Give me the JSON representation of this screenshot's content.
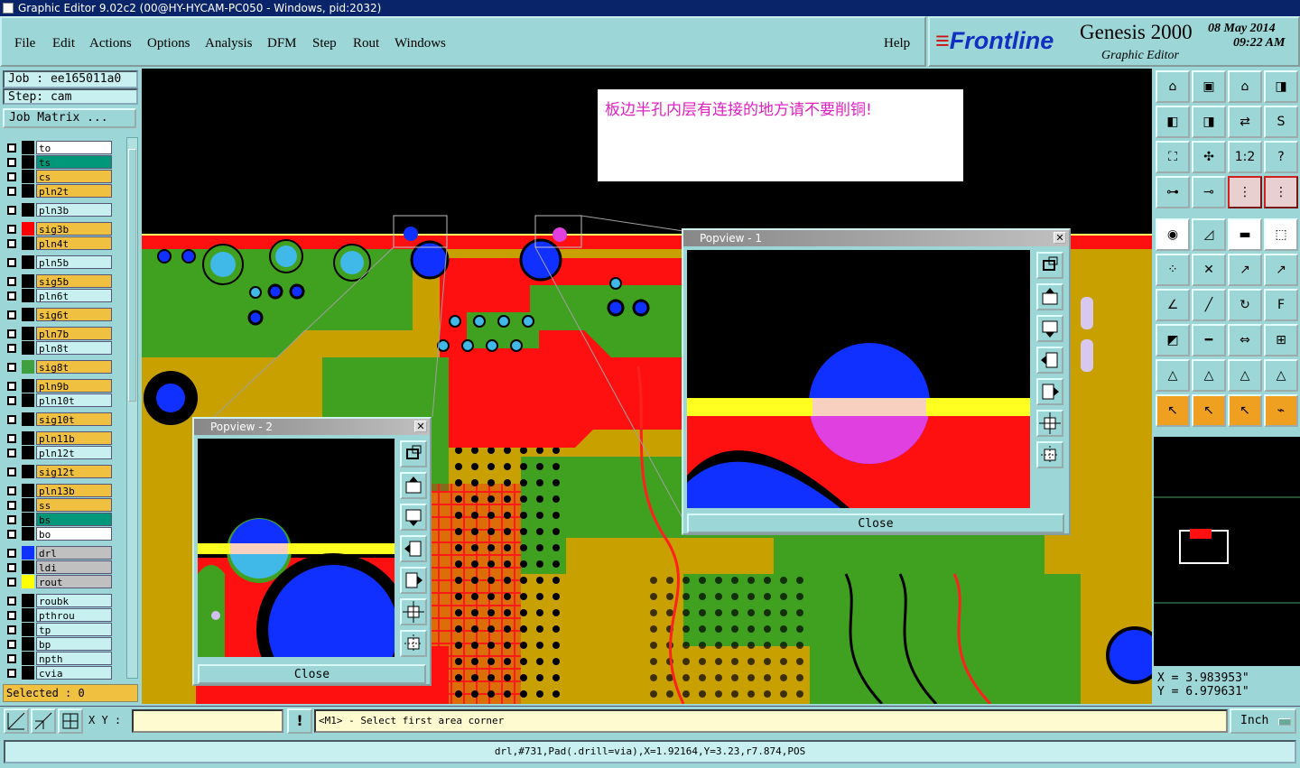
{
  "window": {
    "title": "Graphic Editor 9.02c2 (00@HY-HYCAM-PC050 - Windows, pid:2032)"
  },
  "menu": {
    "items": [
      "File",
      "Edit",
      "Actions",
      "Options",
      "Analysis",
      "DFM",
      "Step",
      "Rout",
      "Windows"
    ],
    "help": "Help"
  },
  "brand": {
    "logo": "Frontline",
    "product": "Genesis 2000",
    "subtitle": "Graphic Editor",
    "date": "08 May 2014",
    "time": "09:22 AM"
  },
  "job": {
    "name": "Job : ee165011a0",
    "step": "Step: cam",
    "matrix_button": "Job Matrix ..."
  },
  "layers": [
    {
      "name": "to",
      "color": "#ffffff",
      "swatch": "#000000"
    },
    {
      "name": "ts",
      "color": "#009878",
      "swatch": "#000000"
    },
    {
      "name": "cs",
      "color": "#f0c040",
      "swatch": "#000000"
    },
    {
      "name": "pln2t",
      "color": "#f0c040",
      "swatch": "#000000"
    },
    {
      "name": "pln3b",
      "color": "#c8f0f0",
      "swatch": "#000000"
    },
    {
      "name": "sig3b",
      "color": "#f0c040",
      "swatch": "#ff0000"
    },
    {
      "name": "pln4t",
      "color": "#f0c040",
      "swatch": "#000000"
    },
    {
      "name": "pln5b",
      "color": "#c8f0f0",
      "swatch": "#000000"
    },
    {
      "name": "sig5b",
      "color": "#f0c040",
      "swatch": "#000000"
    },
    {
      "name": "pln6t",
      "color": "#c8f0f0",
      "swatch": "#000000"
    },
    {
      "name": "sig6t",
      "color": "#f0c040",
      "swatch": "#000000"
    },
    {
      "name": "pln7b",
      "color": "#f0c040",
      "swatch": "#000000"
    },
    {
      "name": "pln8t",
      "color": "#c8f0f0",
      "swatch": "#000000"
    },
    {
      "name": "sig8t",
      "color": "#f0c040",
      "swatch": "#40a040"
    },
    {
      "name": "pln9b",
      "color": "#f0c040",
      "swatch": "#000000"
    },
    {
      "name": "pln10t",
      "color": "#c8f0f0",
      "swatch": "#000000"
    },
    {
      "name": "sig10t",
      "color": "#f0c040",
      "swatch": "#000000"
    },
    {
      "name": "pln11b",
      "color": "#f0c040",
      "swatch": "#000000"
    },
    {
      "name": "pln12t",
      "color": "#c8f0f0",
      "swatch": "#000000"
    },
    {
      "name": "sig12t",
      "color": "#f0c040",
      "swatch": "#000000"
    },
    {
      "name": "pln13b",
      "color": "#f0c040",
      "swatch": "#000000"
    },
    {
      "name": "ss",
      "color": "#f0c040",
      "swatch": "#000000"
    },
    {
      "name": "bs",
      "color": "#009878",
      "swatch": "#000000"
    },
    {
      "name": "bo",
      "color": "#ffffff",
      "swatch": "#000000"
    },
    {
      "name": "drl",
      "color": "#c0c0c0",
      "swatch": "#1030ff"
    },
    {
      "name": "ldi",
      "color": "#c0c0c0",
      "swatch": "#000000"
    },
    {
      "name": "rout",
      "color": "#c0c0c0",
      "swatch": "#ffff00"
    },
    {
      "name": "roubk",
      "color": "#c8f0f0",
      "swatch": "#000000"
    },
    {
      "name": "pthrou",
      "color": "#c8f0f0",
      "swatch": "#000000"
    },
    {
      "name": "tp",
      "color": "#c8f0f0",
      "swatch": "#000000"
    },
    {
      "name": "bp",
      "color": "#c8f0f0",
      "swatch": "#000000"
    },
    {
      "name": "npth",
      "color": "#c8f0f0",
      "swatch": "#000000"
    },
    {
      "name": "cvia",
      "color": "#c8f0f0",
      "swatch": "#000000"
    }
  ],
  "selected": "Selected : 0",
  "note": {
    "text": "板边半孔内层有连接的地方请不要削铜!"
  },
  "popview1": {
    "title": "Popview - 1",
    "close": "Close"
  },
  "popview2": {
    "title": "Popview - 2",
    "close": "Close"
  },
  "coords": {
    "x": "X =  3.983953\"",
    "y": "Y =  6.979631\""
  },
  "bottom": {
    "xy_label": "X Y :",
    "xy_value": "",
    "prompt": "<M1> - Select first area corner",
    "units": "Inch"
  },
  "status": {
    "text": "drl,#731,Pad(.drill=via),X=1.92164,Y=3.23,r7.874,POS"
  },
  "colors": {
    "panel": "#9cd6d6",
    "field": "#c8f0f0",
    "board_olive": "#c8a000",
    "board_green": "#40a020",
    "board_red": "#ff1010",
    "via_blue": "#1030ff",
    "title_blue": "#0a246a"
  }
}
